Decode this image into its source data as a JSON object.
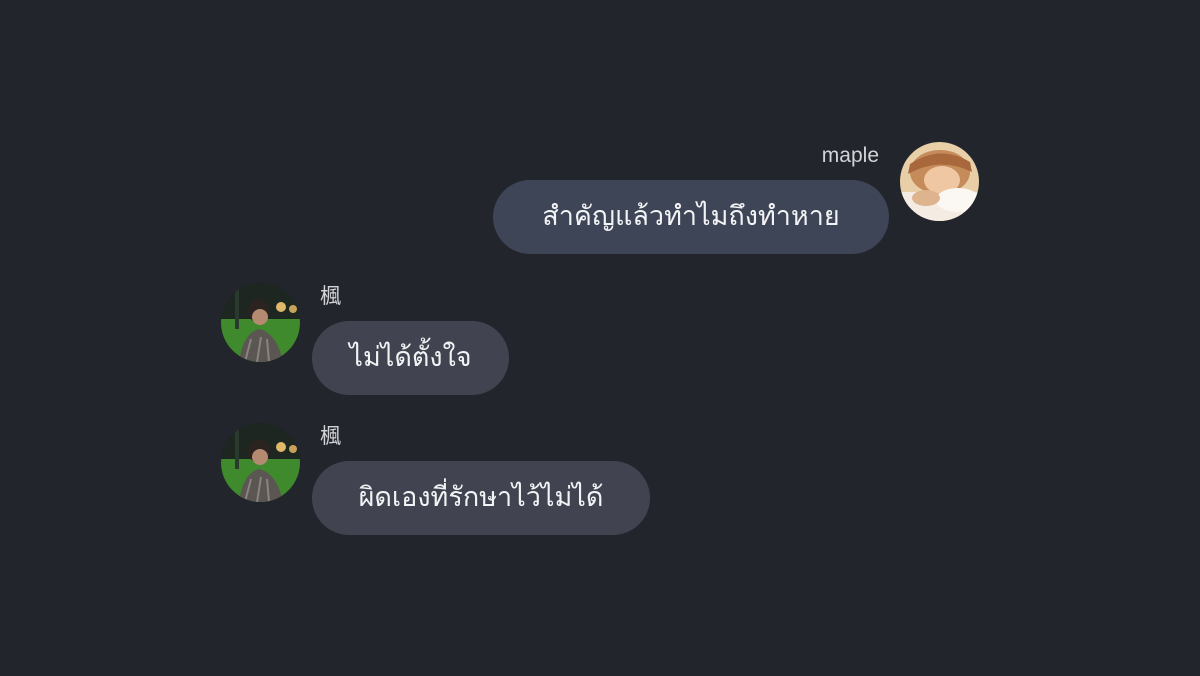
{
  "messages": [
    {
      "direction": "outgoing",
      "sender": "maple",
      "text": "สำคัญแล้วทำไมถึงทำหาย"
    },
    {
      "direction": "incoming",
      "sender": "楓",
      "text": "ไม่ได้ตั้งใจ"
    },
    {
      "direction": "incoming",
      "sender": "楓",
      "text": "ผิดเองที่รักษาไว้ไม่ได้"
    }
  ],
  "colors": {
    "background": "#23252d",
    "outgoing_bubble": "#3e4556",
    "incoming_bubble": "#414450",
    "name_text": "#d3d4d8",
    "message_text": "#f2f3f5"
  }
}
